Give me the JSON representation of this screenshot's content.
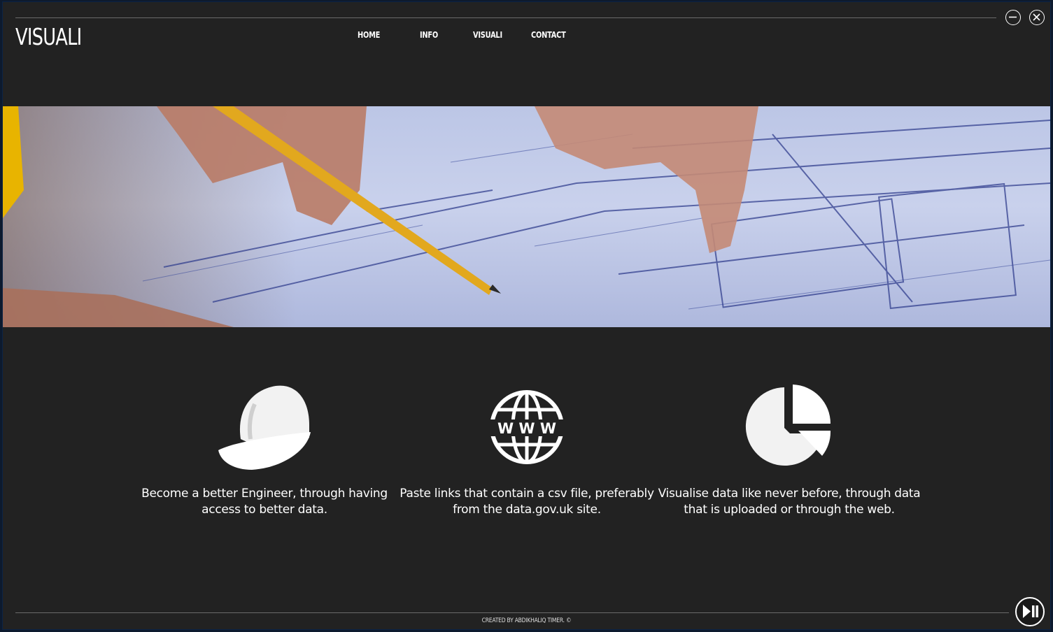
{
  "app": {
    "logo": "VISUALI"
  },
  "nav": {
    "items": [
      {
        "label": "HOME"
      },
      {
        "label": "INFO"
      },
      {
        "label": "VISUALI"
      },
      {
        "label": "CONTACT"
      }
    ]
  },
  "window_controls": {
    "minimize_icon": "minimize-circle-icon",
    "close_icon": "close-circle-icon"
  },
  "hero": {
    "description_icon": "blueprint-image"
  },
  "features": [
    {
      "icon": "hard-hat-icon",
      "text": "Become a better Engineer, through having access to better data."
    },
    {
      "icon": "globe-www-icon",
      "text": "Paste links that contain a csv file, preferably from the data.gov.uk site."
    },
    {
      "icon": "pie-chart-icon",
      "text": "Visualise data like never before, through data that is uploaded or through the web."
    }
  ],
  "footer": {
    "credit": "CREATED BY ABDIKHALIQ TIMER.  ©"
  },
  "media": {
    "icon": "play-pause-icon"
  },
  "colors": {
    "background": "#222222",
    "text": "#ffffff",
    "frame": "#0d1a2e"
  }
}
